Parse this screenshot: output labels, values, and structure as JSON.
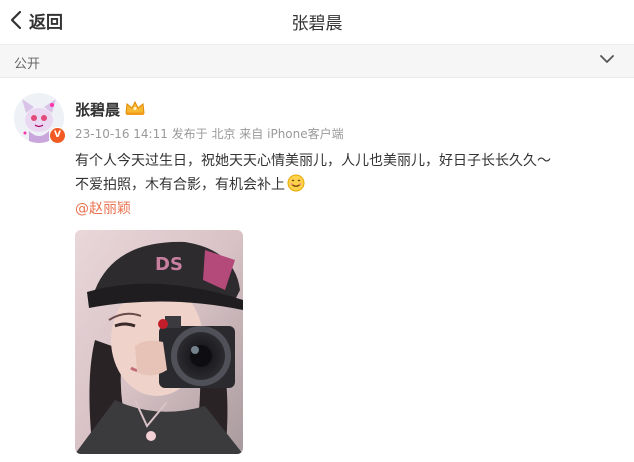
{
  "header": {
    "back_label": "返回",
    "title": "张碧晨"
  },
  "visibility": {
    "label": "公开"
  },
  "post": {
    "username": "张碧晨",
    "meta": "23-10-16 14:11  发布于 北京  来自 iPhone客户端",
    "line1": "有个人今天过生日，祝她天天心情美丽儿，人儿也美丽儿，好日子长长久久～",
    "line2": "不爱拍照，木有合影，有机会补上",
    "mention": "@赵丽颖",
    "verified_badge": "V",
    "icons": {
      "badge": "crown-icon",
      "emoji": "smile-emoji-icon"
    }
  },
  "colors": {
    "mention": "#eb7350",
    "verified": "#f15a22",
    "meta": "#999999"
  }
}
